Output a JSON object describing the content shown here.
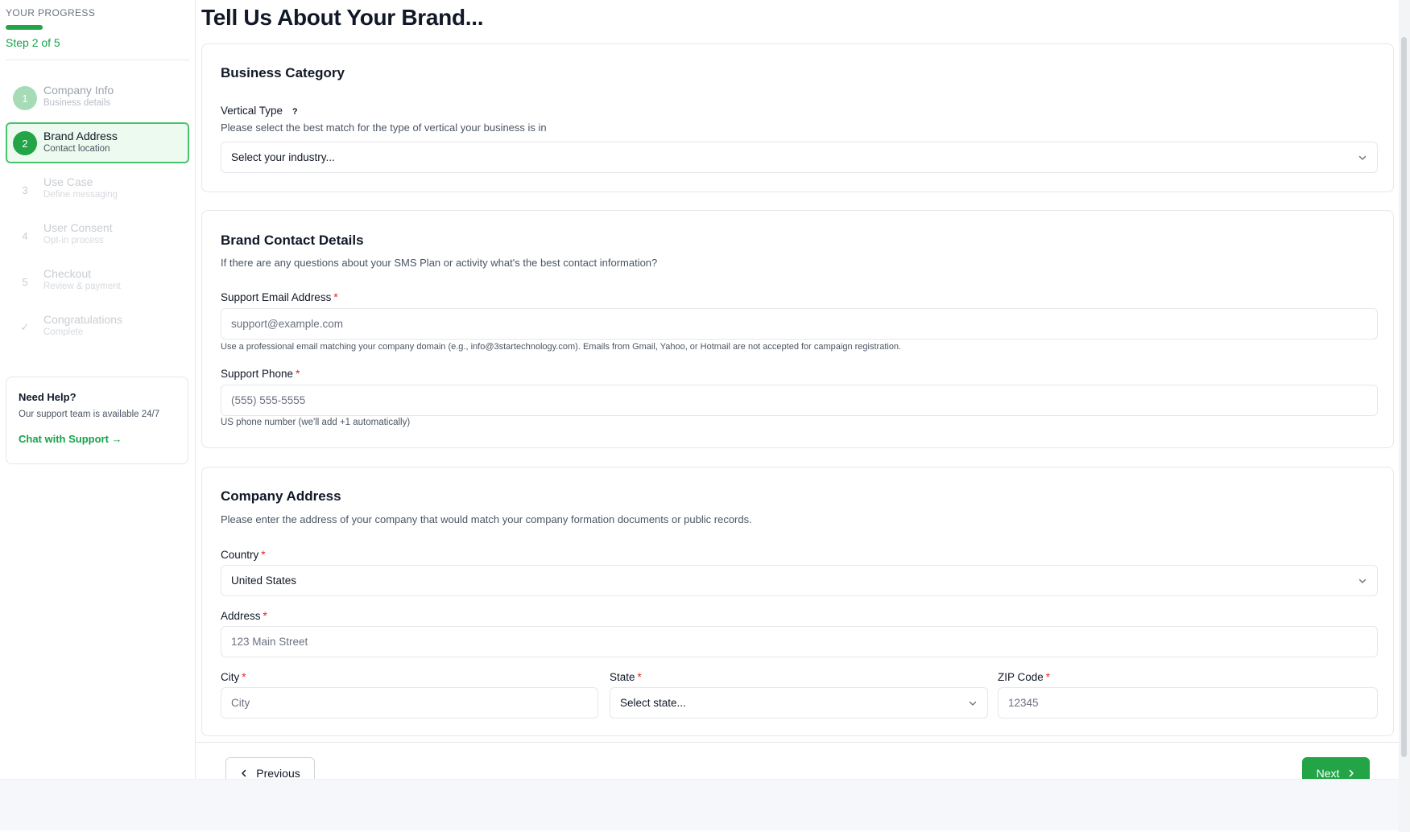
{
  "sidebar": {
    "progress_label": "YOUR PROGRESS",
    "progress_fraction": 0.4,
    "step_text": "Step 2 of 5",
    "steps": [
      {
        "num": "1",
        "title": "Company Info",
        "sub": "Business details",
        "state": "done"
      },
      {
        "num": "2",
        "title": "Brand Address",
        "sub": "Contact location",
        "state": "active"
      },
      {
        "num": "3",
        "title": "Use Case",
        "sub": "Define messaging",
        "state": "pending"
      },
      {
        "num": "4",
        "title": "User Consent",
        "sub": "Opt-in process",
        "state": "pending"
      },
      {
        "num": "5",
        "title": "Checkout",
        "sub": "Review & payment",
        "state": "pending"
      },
      {
        "num": "✓",
        "title": "Congratulations",
        "sub": "Complete",
        "state": "pending"
      }
    ],
    "help": {
      "title": "Need Help?",
      "text": "Our support team is available 24/7",
      "link": "Chat with Support →"
    }
  },
  "main": {
    "title": "Tell Us About Your Brand...",
    "business_category": {
      "title": "Business Category",
      "vertical_label": "Vertical Type",
      "vertical_help": "?",
      "vertical_desc": "Please select the best match for the type of vertical your business is in",
      "vertical_select": "Select your industry..."
    },
    "contact": {
      "title": "Brand Contact Details",
      "desc": "If there are any questions about your SMS Plan or activity what's the best contact information?",
      "email_label": "Support Email Address",
      "email_placeholder": "support@example.com",
      "email_hint": "Use a professional email matching your company domain (e.g., info@3startechnology.com). Emails from Gmail, Yahoo, or Hotmail are not accepted for campaign registration.",
      "phone_label": "Support Phone",
      "phone_placeholder": "(555) 555-5555",
      "phone_hint": "US phone number (we'll add +1 automatically)"
    },
    "address": {
      "title": "Company Address",
      "desc": "Please enter the address of your company that would match your company formation documents or public records.",
      "country_label": "Country",
      "country_value": "United States",
      "address_label": "Address",
      "address_placeholder": "123 Main Street",
      "city_label": "City",
      "city_placeholder": "City",
      "state_label": "State",
      "state_select": "Select state...",
      "zip_label": "ZIP Code",
      "zip_placeholder": "12345"
    },
    "required_mark": "*",
    "buttons": {
      "previous": "Previous",
      "next": "Next"
    }
  },
  "colors": {
    "accent": "#22a447",
    "active_bg": "#ecfaef",
    "required": "#dc2626"
  }
}
